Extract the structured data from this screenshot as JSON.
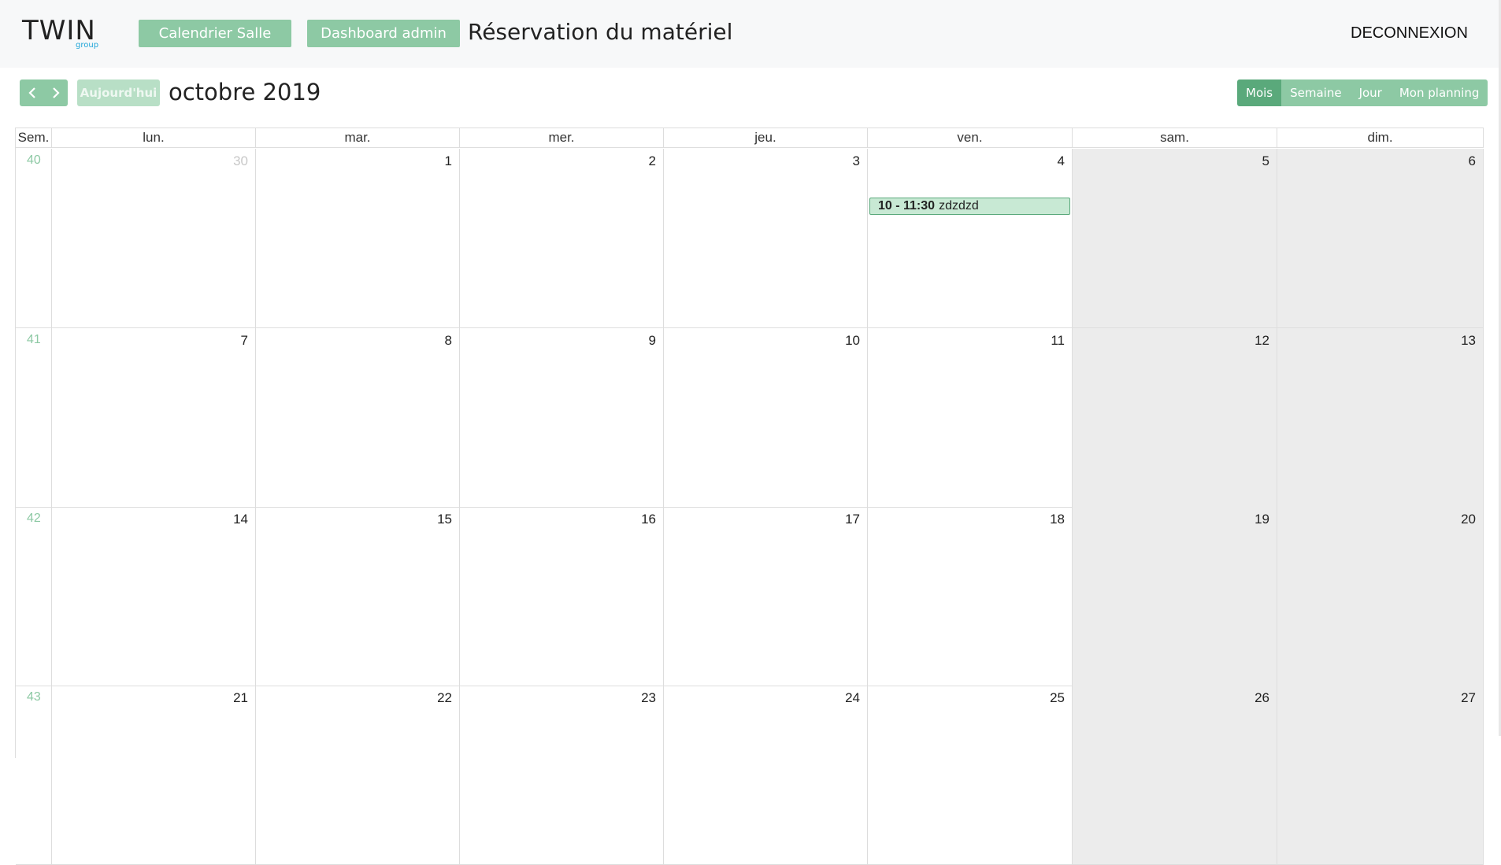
{
  "header": {
    "logo": {
      "main": "TWIN",
      "sub": "group"
    },
    "nav": {
      "room_calendar": "Calendrier Salle",
      "admin_dashboard": "Dashboard admin"
    },
    "page_title": "Réservation du matériel",
    "logout": "DECONNEXION"
  },
  "toolbar": {
    "today": "Aujourd'hui",
    "title": "octobre 2019",
    "views": {
      "month": "Mois",
      "week": "Semaine",
      "day": "Jour",
      "my_planning": "Mon planning"
    },
    "active_view": "Mois"
  },
  "calendar": {
    "week_header": "Sem.",
    "day_headers": [
      "lun.",
      "mar.",
      "mer.",
      "jeu.",
      "ven.",
      "sam.",
      "dim."
    ],
    "rows": [
      {
        "week": "40",
        "days": [
          "30",
          "1",
          "2",
          "3",
          "4",
          "5",
          "6"
        ]
      },
      {
        "week": "41",
        "days": [
          "7",
          "8",
          "9",
          "10",
          "11",
          "12",
          "13"
        ]
      },
      {
        "week": "42",
        "days": [
          "14",
          "15",
          "16",
          "17",
          "18",
          "19",
          "20"
        ]
      },
      {
        "week": "43",
        "days": [
          "21",
          "22",
          "23",
          "24",
          "25",
          "26",
          "27"
        ]
      }
    ],
    "events": [
      {
        "row": 0,
        "col": 4,
        "time": "10 - 11:30",
        "title": "zdzdzd"
      }
    ]
  },
  "colors": {
    "accent": "#8dc9a4",
    "accent_active": "#5aa97b",
    "week_number": "#8dc9a4",
    "weekend_bg": "#ececec",
    "event_bg": "#c8e9d4"
  }
}
